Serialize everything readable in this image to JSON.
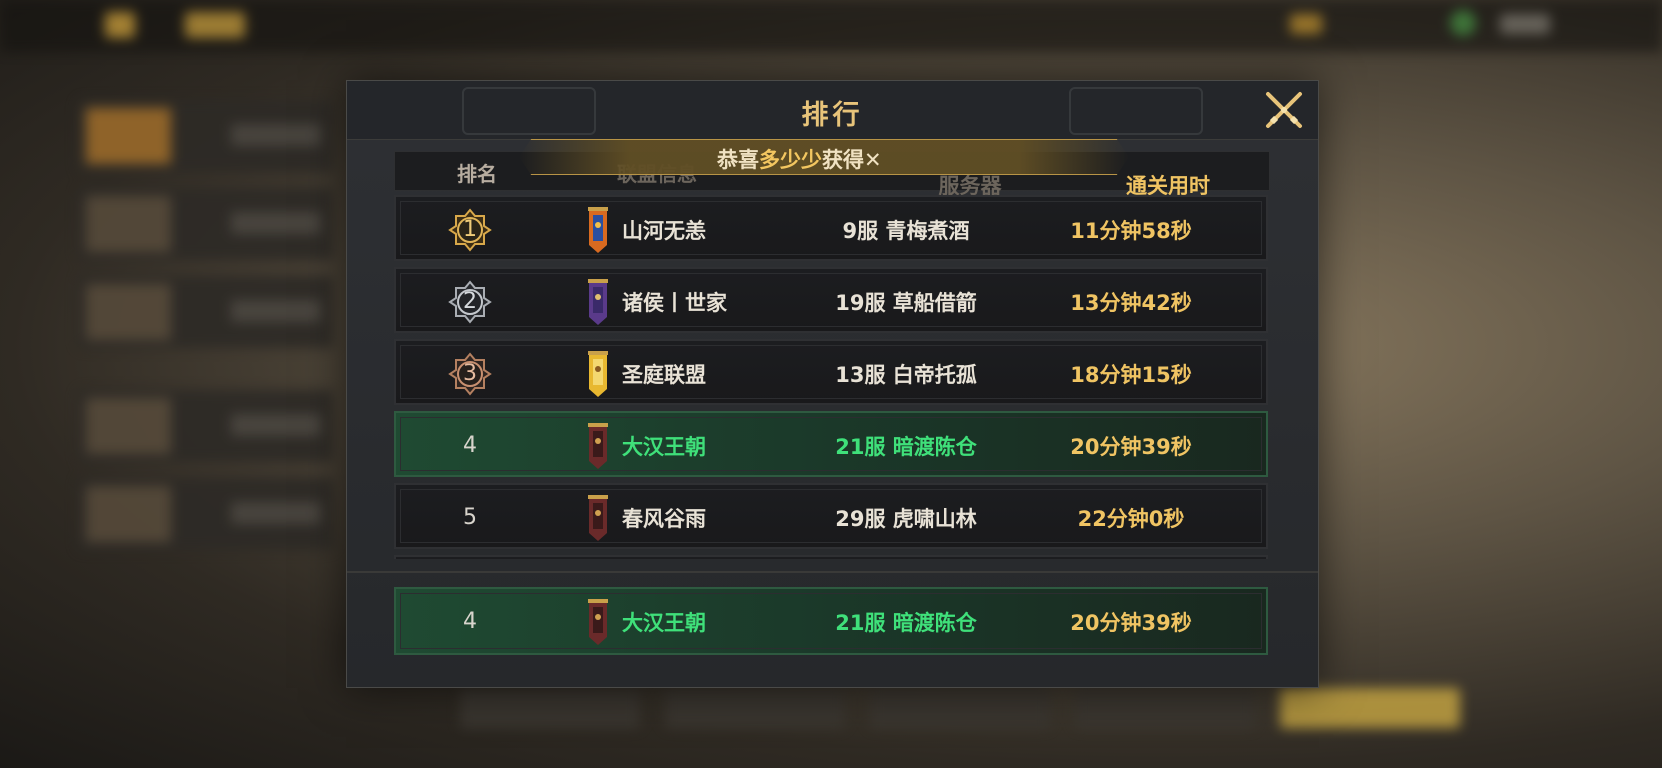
{
  "modal": {
    "title": "排行"
  },
  "marquee": {
    "prefix": "恭喜",
    "highlight": "多少少",
    "suffix": "获得"
  },
  "table": {
    "headers": {
      "rank": "排名",
      "alliance": "联盟信息",
      "server": "服务器",
      "time": "通关用时"
    },
    "rows": [
      {
        "rank": "1",
        "alliance": "山河无恙",
        "server": "9服  青梅煮酒",
        "time": "11分钟58秒",
        "medal": "gold",
        "banner": "orange-blue",
        "self": false
      },
      {
        "rank": "2",
        "alliance": "诸侯丨世家",
        "server": "19服  草船借箭",
        "time": "13分钟42秒",
        "medal": "silver",
        "banner": "purple",
        "self": false
      },
      {
        "rank": "3",
        "alliance": "圣庭联盟",
        "server": "13服  白帝托孤",
        "time": "18分钟15秒",
        "medal": "bronze",
        "banner": "yellow",
        "self": false
      },
      {
        "rank": "4",
        "alliance": "大汉王朝",
        "server": "21服  暗渡陈仓",
        "time": "20分钟39秒",
        "medal": "none",
        "banner": "dark-red",
        "self": true
      },
      {
        "rank": "5",
        "alliance": "春风谷雨",
        "server": "29服  虎啸山林",
        "time": "22分钟0秒",
        "medal": "none",
        "banner": "dark-red",
        "self": false
      }
    ],
    "my_rank": {
      "rank": "4",
      "alliance": "大汉王朝",
      "server": "21服  暗渡陈仓",
      "time": "20分钟39秒"
    }
  },
  "colors": {
    "title_gold": "#e8c47a",
    "time_gold": "#f0c463",
    "self_green": "#3fe07a",
    "panel_bg": "#26282b"
  },
  "icons": {
    "close": "crossed-swords-icon",
    "medal_gold": "rank-1-medal-icon",
    "medal_silver": "rank-2-medal-icon",
    "medal_bronze": "rank-3-medal-icon",
    "banner": "alliance-banner-icon"
  }
}
